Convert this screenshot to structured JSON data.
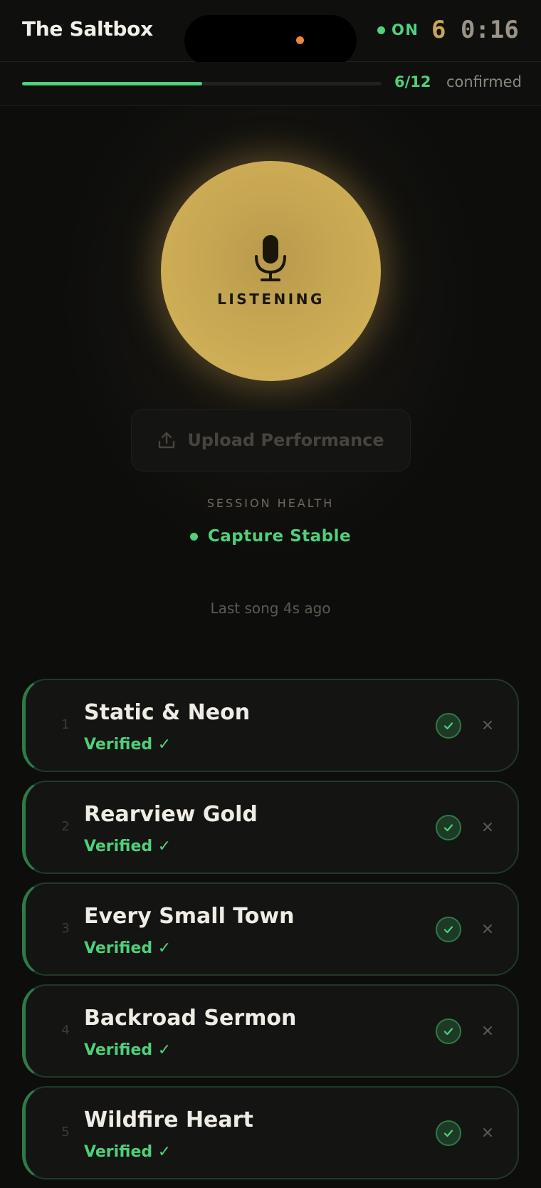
{
  "header": {
    "title": "The Saltbox",
    "live_label": "ON",
    "timer_prefix": "6",
    "timer_main": "0:16"
  },
  "progress": {
    "count": "6/12",
    "label": "confirmed",
    "fraction": 0.5
  },
  "listen": {
    "label": "LISTENING",
    "icon": "microphone-icon"
  },
  "upload": {
    "label": "Upload Performance",
    "icon": "upload-icon"
  },
  "health": {
    "heading": "SESSION HEALTH",
    "status": "Capture Stable"
  },
  "last_song": "Last song 4s ago",
  "songs": [
    {
      "num": "1",
      "title": "Static & Neon",
      "status": "Verified ✓"
    },
    {
      "num": "2",
      "title": "Rearview Gold",
      "status": "Verified ✓"
    },
    {
      "num": "3",
      "title": "Every Small Town",
      "status": "Verified ✓"
    },
    {
      "num": "4",
      "title": "Backroad Sermon",
      "status": "Verified ✓"
    },
    {
      "num": "5",
      "title": "Wildfire Heart",
      "status": "Verified ✓"
    }
  ],
  "colors": {
    "accent_green": "#4fd07a",
    "accent_gold": "#c9a557",
    "background": "#0d0d0c"
  }
}
